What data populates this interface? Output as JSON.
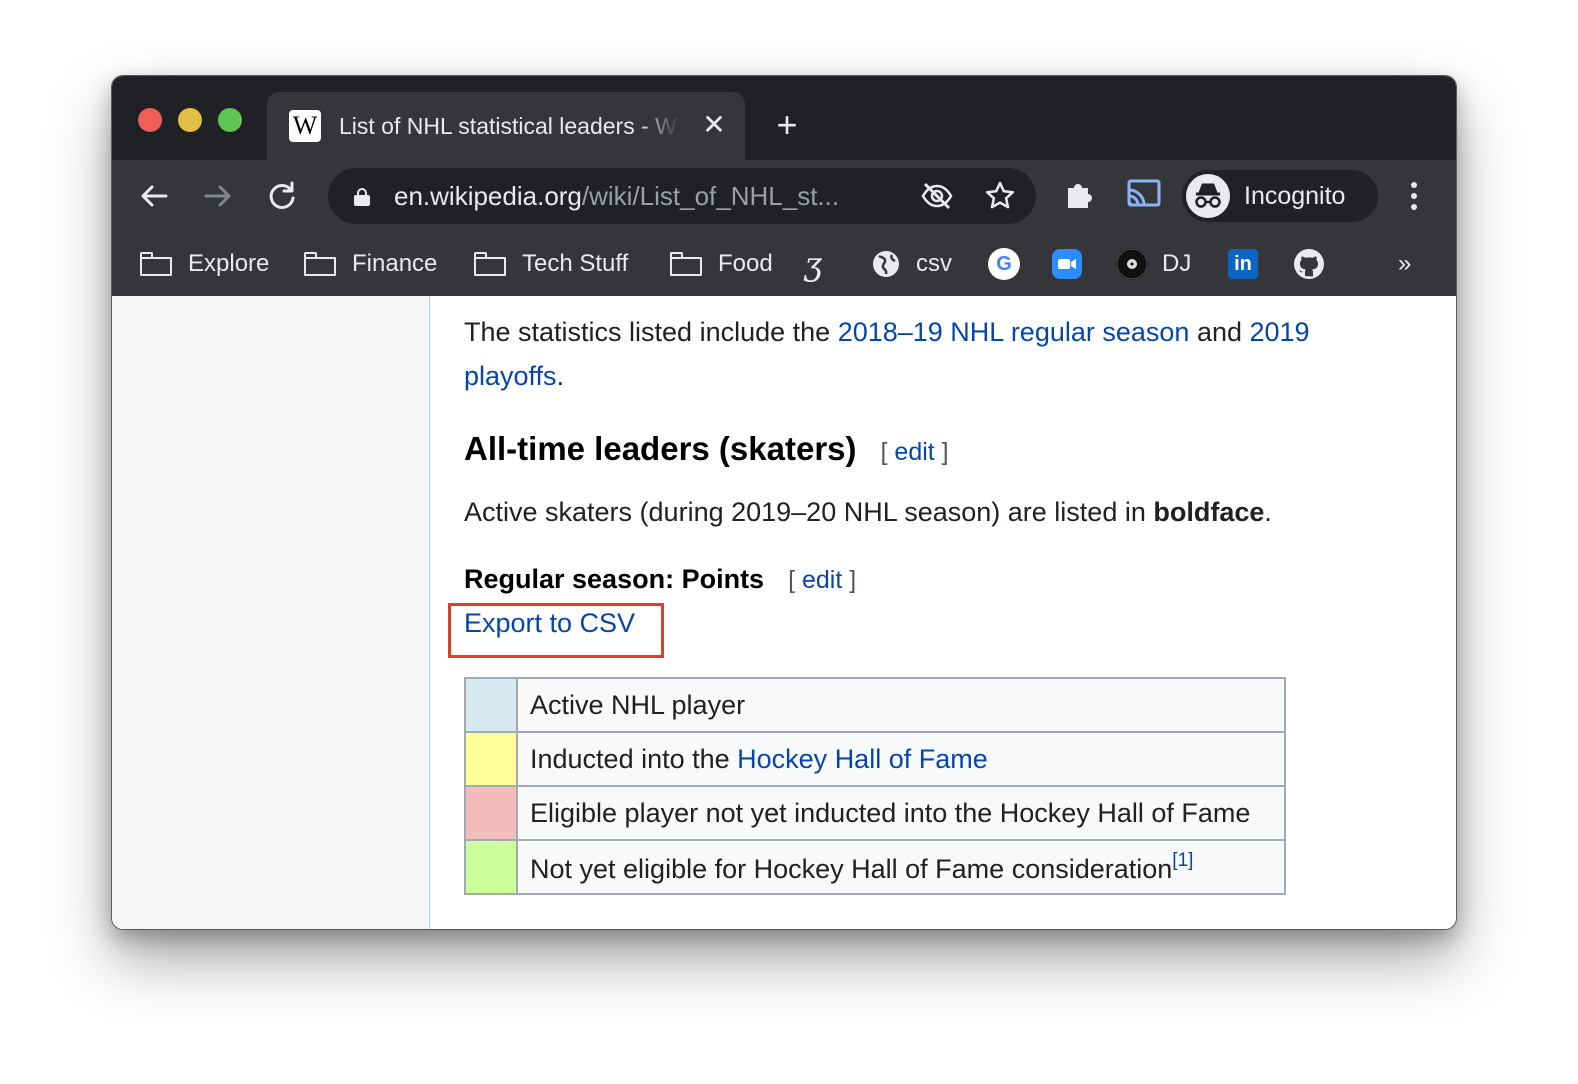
{
  "browser": {
    "tab_title": "List of NHL statistical leaders - Wikipedia",
    "tab_favicon": "W",
    "url_host": "en.wikipedia.org",
    "url_path": "/wiki/List_of_NHL_st...",
    "profile_label": "Incognito",
    "bookmarks": [
      "Explore",
      "Finance",
      "Tech Stuff",
      "Food",
      "csv",
      "DJ"
    ],
    "overflow_label": "»",
    "icons": [
      "back-arrow-icon",
      "forward-arrow-icon",
      "reload-icon",
      "lock-icon",
      "eye-off-icon",
      "star-icon",
      "extensions-icon",
      "cast-icon",
      "incognito-icon",
      "menu-icon"
    ]
  },
  "article": {
    "intro_text": "The statistics listed include the ",
    "intro_link1": "2018–19 NHL regular season",
    "intro_and": " and ",
    "intro_link2": "2019 playoffs",
    "intro_end": ".",
    "heading": "All-time leaders (skaters)",
    "edit_open": "[ ",
    "edit_label": "edit",
    "edit_close": " ]",
    "active_text": "Active skaters (during 2019–20 NHL season) are listed in ",
    "active_bold": "boldface",
    "active_end": ".",
    "subheading": "Regular season: Points",
    "export_label": "Export to CSV",
    "legend": [
      {
        "color": "#d5e9ee",
        "text": "Active NHL player"
      },
      {
        "color": "#ffff99",
        "text_prefix": "Inducted into the ",
        "link": "Hockey Hall of Fame"
      },
      {
        "color": "#f5bcbc",
        "text": "Eligible player not yet inducted into the Hockey Hall of Fame"
      },
      {
        "color": "#ccff99",
        "text": "Not yet eligible for Hockey Hall of Fame consideration",
        "ref": "[1]"
      }
    ]
  }
}
